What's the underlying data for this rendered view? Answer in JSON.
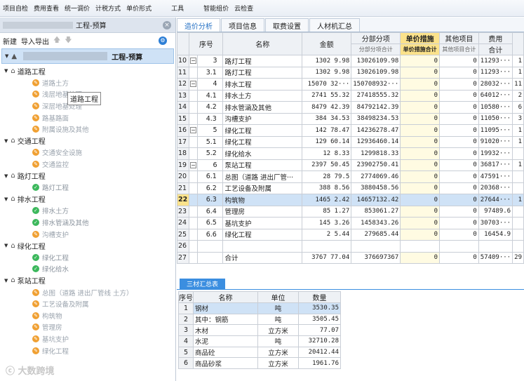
{
  "toolbar": {
    "items": [
      "项目自检",
      "费用查看",
      "统一调价",
      "计税方式",
      "单价形式",
      "工具",
      "智能组价",
      "云检查"
    ]
  },
  "left": {
    "title": "工程-预算",
    "actions": {
      "new": "新建",
      "import_export": "导入导出"
    },
    "root_label": "工程-预算",
    "tooltip": "道路工程",
    "tree": [
      {
        "label": "道路工程",
        "children": [
          {
            "label": "道路土方",
            "status": "orange"
          },
          {
            "label": "浅层地基处理",
            "status": "orange"
          },
          {
            "label": "深层地基处理",
            "status": "orange"
          },
          {
            "label": "路基路面",
            "status": "orange"
          },
          {
            "label": "附属设施及其他",
            "status": "orange"
          }
        ]
      },
      {
        "label": "交通工程",
        "children": [
          {
            "label": "交通安全设施",
            "status": "orange"
          },
          {
            "label": "交通监控",
            "status": "orange"
          }
        ]
      },
      {
        "label": "路灯工程",
        "children": [
          {
            "label": "路灯工程",
            "status": "green"
          }
        ]
      },
      {
        "label": "排水工程",
        "children": [
          {
            "label": "排水土方",
            "status": "green"
          },
          {
            "label": "排水管涵及其他",
            "status": "green"
          },
          {
            "label": "沟槽支护",
            "status": "orange"
          }
        ]
      },
      {
        "label": "绿化工程",
        "children": [
          {
            "label": "绿化工程",
            "status": "green"
          },
          {
            "label": "绿化给水",
            "status": "green"
          }
        ]
      },
      {
        "label": "泵站工程",
        "children": [
          {
            "label": "总图（道路 进出厂管线 土方）",
            "status": "orange"
          },
          {
            "label": "工艺设备及附属",
            "status": "orange"
          },
          {
            "label": "构筑物",
            "status": "orange"
          },
          {
            "label": "管理房",
            "status": "orange"
          },
          {
            "label": "基坑支护",
            "status": "orange"
          },
          {
            "label": "绿化工程",
            "status": "orange"
          }
        ]
      }
    ],
    "watermark": "大数跨境"
  },
  "tabs": [
    "造价分析",
    "项目信息",
    "取费设置",
    "人材机汇总"
  ],
  "main_grid": {
    "headers": {
      "seq": "序号",
      "name": "名称",
      "amount": "金额",
      "fenbu": "分部分项",
      "fenbu_sub": "分部分项合计",
      "danjia": "单价措施",
      "danjia_sub": "单价措施合计",
      "other": "其他项目",
      "other_sub": "其他项目合计",
      "fee": "费用",
      "fee_sub": "合计"
    },
    "rows": [
      {
        "rn": "10",
        "exp": "−",
        "seq": "3",
        "name": "路灯工程",
        "amt": "1302  9.98",
        "fenbu": "13026109.98",
        "danjia": "0",
        "other": "0",
        "fee": "11293···",
        "extra": "1"
      },
      {
        "rn": "11",
        "exp": "",
        "seq": "3.1",
        "name": "路灯工程",
        "amt": "1302  9.98",
        "fenbu": "13026109.98",
        "danjia": "0",
        "other": "0",
        "fee": "11293···",
        "extra": "1"
      },
      {
        "rn": "12",
        "exp": "−",
        "seq": "4",
        "name": "排水工程",
        "amt": "15070  32···",
        "fenbu": "150708932···",
        "danjia": "0",
        "other": "0",
        "fee": "28032···",
        "extra": "11"
      },
      {
        "rn": "13",
        "exp": "",
        "seq": "4.1",
        "name": "排水土方",
        "amt": "2741  55.32",
        "fenbu": "27418555.32",
        "danjia": "0",
        "other": "0",
        "fee": "64012···",
        "extra": "2"
      },
      {
        "rn": "14",
        "exp": "",
        "seq": "4.2",
        "name": "排水管涵及其他",
        "amt": "8479  42.39",
        "fenbu": "84792142.39",
        "danjia": "0",
        "other": "0",
        "fee": "10580···",
        "extra": "6"
      },
      {
        "rn": "15",
        "exp": "",
        "seq": "4.3",
        "name": "沟槽支护",
        "amt": "384  34.53",
        "fenbu": "38498234.53",
        "danjia": "0",
        "other": "0",
        "fee": "11050···",
        "extra": "3"
      },
      {
        "rn": "16",
        "exp": "−",
        "seq": "5",
        "name": "绿化工程",
        "amt": "142  78.47",
        "fenbu": "14236278.47",
        "danjia": "0",
        "other": "0",
        "fee": "11095···",
        "extra": "1"
      },
      {
        "rn": "17",
        "exp": "",
        "seq": "5.1",
        "name": "绿化工程",
        "amt": "129  60.14",
        "fenbu": "12936460.14",
        "danjia": "0",
        "other": "0",
        "fee": "91020···",
        "extra": "1"
      },
      {
        "rn": "18",
        "exp": "",
        "seq": "5.2",
        "name": "绿化给水",
        "amt": "12  8.33",
        "fenbu": "1299818.33",
        "danjia": "0",
        "other": "0",
        "fee": "19932···",
        "extra": ""
      },
      {
        "rn": "19",
        "exp": "−",
        "seq": "6",
        "name": "泵站工程",
        "amt": "2397  50.45",
        "fenbu": "23902750.41",
        "danjia": "0",
        "other": "0",
        "fee": "36817···",
        "extra": "1"
      },
      {
        "rn": "20",
        "exp": "",
        "seq": "6.1",
        "name": "总图（道路 进出厂管···",
        "amt": "28  79.5",
        "fenbu": "2774069.46",
        "danjia": "0",
        "other": "0",
        "fee": "47591···",
        "extra": ""
      },
      {
        "rn": "21",
        "exp": "",
        "seq": "6.2",
        "name": "工艺设备及附属",
        "amt": "388  8.56",
        "fenbu": "3880458.56",
        "danjia": "0",
        "other": "0",
        "fee": "20368···",
        "extra": ""
      },
      {
        "rn": "22",
        "exp": "",
        "seq": "6.3",
        "name": "构筑物",
        "amt": "1465  2.42",
        "fenbu": "14657132.42",
        "danjia": "0",
        "other": "0",
        "fee": "27644···",
        "extra": "1",
        "selected": true
      },
      {
        "rn": "23",
        "exp": "",
        "seq": "6.4",
        "name": "管理房",
        "amt": "85  1.27",
        "fenbu": "853061.27",
        "danjia": "0",
        "other": "0",
        "fee": "97489.6",
        "extra": ""
      },
      {
        "rn": "24",
        "exp": "",
        "seq": "6.5",
        "name": "基坑支护",
        "amt": "145  3.26",
        "fenbu": "1458343.26",
        "danjia": "0",
        "other": "0",
        "fee": "30703···",
        "extra": ""
      },
      {
        "rn": "25",
        "exp": "",
        "seq": "6.6",
        "name": "绿化工程",
        "amt": "2  5.44",
        "fenbu": "279685.44",
        "danjia": "0",
        "other": "0",
        "fee": "16454.9",
        "extra": ""
      },
      {
        "rn": "26",
        "exp": "",
        "seq": "",
        "name": "",
        "amt": "",
        "fenbu": "",
        "danjia": "",
        "other": "",
        "fee": "",
        "extra": "",
        "blank": true
      },
      {
        "rn": "27",
        "exp": "",
        "seq": "",
        "name": "合计",
        "amt": "3767  77.04",
        "fenbu": "376697367",
        "danjia": "0",
        "other": "0",
        "fee": "57409···",
        "extra": "29"
      }
    ]
  },
  "bottom": {
    "tab": "三材汇总表",
    "headers": {
      "no": "序号",
      "name": "名称",
      "unit": "单位",
      "qty": "数量"
    },
    "rows": [
      {
        "no": "1",
        "name": "钢材",
        "unit": "吨",
        "qty": "3530.35",
        "selected": true
      },
      {
        "no": "2",
        "name": "其中：钢筋",
        "unit": "吨",
        "qty": "3505.45"
      },
      {
        "no": "3",
        "name": "木材",
        "unit": "立方米",
        "qty": "77.07"
      },
      {
        "no": "4",
        "name": "水泥",
        "unit": "吨",
        "qty": "32710.28"
      },
      {
        "no": "5",
        "name": "商品砼",
        "unit": "立方米",
        "qty": "20412.44"
      },
      {
        "no": "6",
        "name": "商品砂浆",
        "unit": "立方米",
        "qty": "1961.76"
      }
    ]
  }
}
